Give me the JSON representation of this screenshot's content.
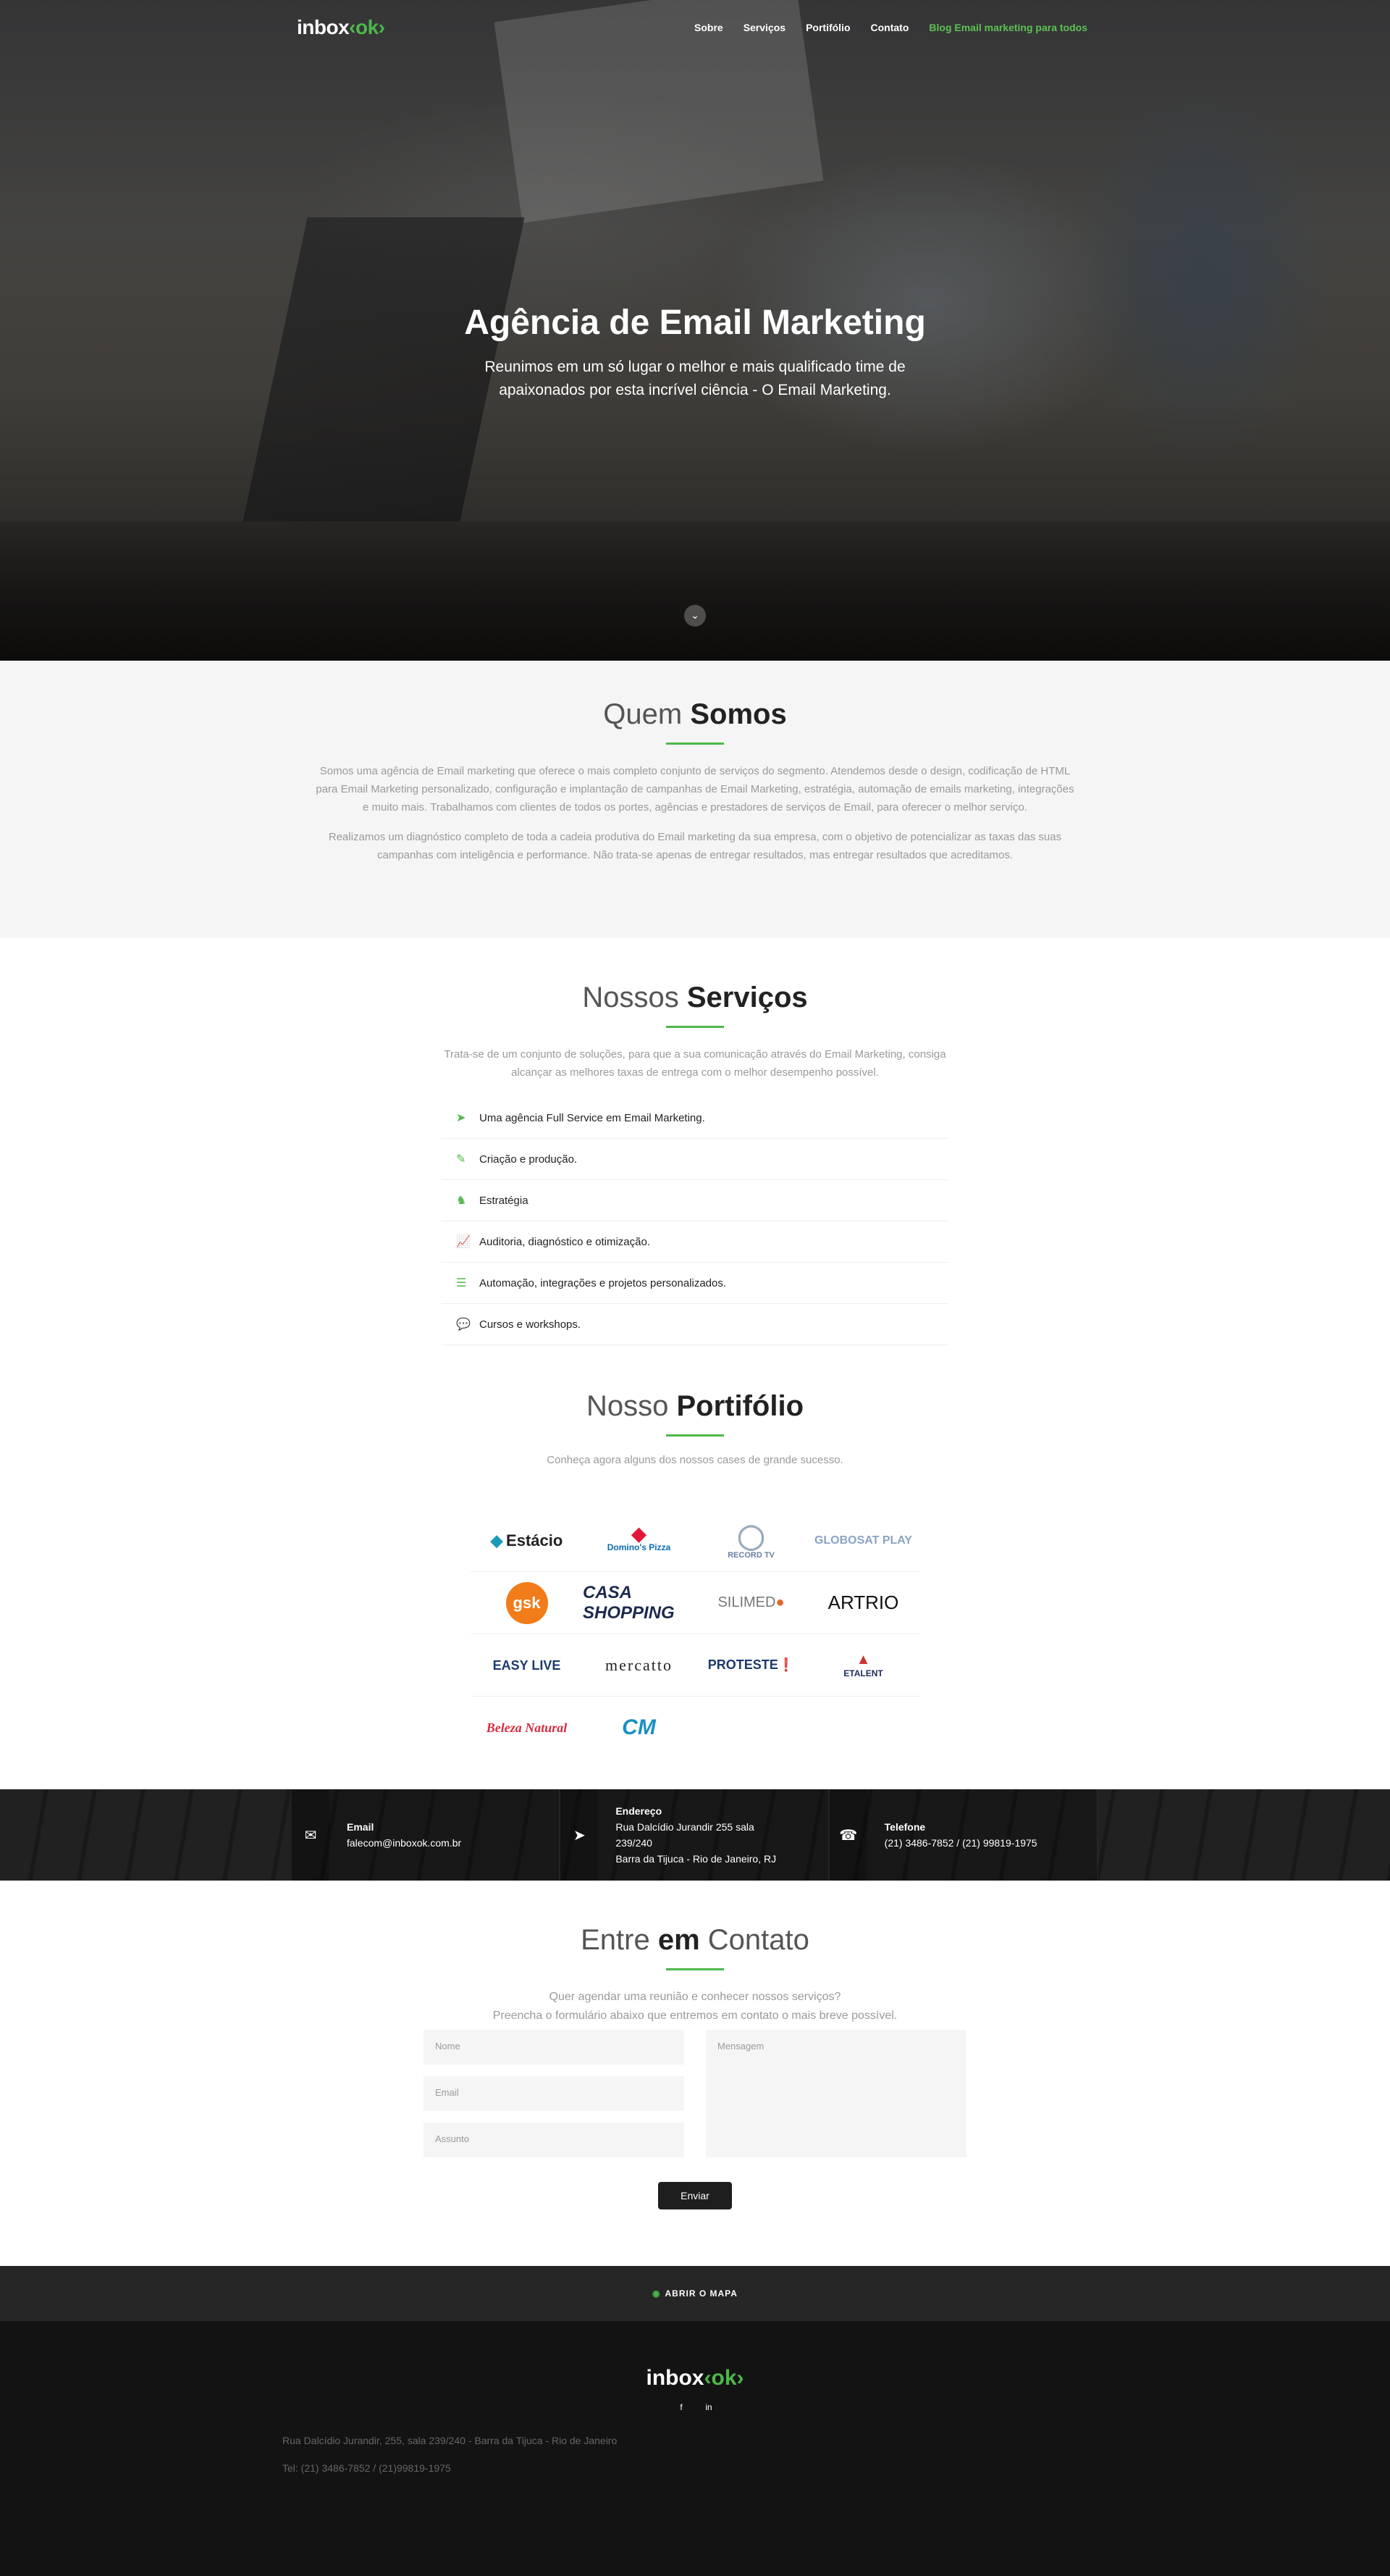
{
  "nav": {
    "logo_main": "inbox",
    "logo_accent": "‹ok›",
    "items": [
      "Sobre",
      "Serviços",
      "Portifólio",
      "Contato",
      "Blog Email marketing para todos"
    ]
  },
  "hero": {
    "title": "Agência de Email Marketing",
    "subtitle": "Reunimos em um só lugar o melhor e mais qualificado time de apaixonados por esta incrível ciência - O Email Marketing.",
    "scroll_icon": "chevron-down-icon"
  },
  "about": {
    "title_light": "Quem",
    "title_bold": "Somos",
    "paragraphs": [
      "Somos uma agência de Email marketing que oferece o mais completo conjunto de serviços do segmento. Atendemos desde o design, codificação de HTML para Email Marketing personalizado, configuração e implantação de campanhas de Email Marketing, estratégia, automação de emails marketing, integrações e muito mais. Trabalhamos com clientes de todos os portes, agências e prestadores de serviços de Email, para oferecer o melhor serviço.",
      "Realizamos um diagnóstico completo de toda a cadeia produtiva do Email marketing da sua empresa, com o objetivo de potencializar as taxas das suas campanhas com inteligência e performance. Não trata-se apenas de entregar resultados, mas entregar resultados que acreditamos."
    ]
  },
  "services": {
    "title_light": "Nossos",
    "title_bold": "Serviços",
    "intro": "Trata-se de um conjunto de soluções, para que a sua comunicação através do Email Marketing, consiga alcançar as melhores taxas de entrega com o melhor desempenho possível.",
    "items": [
      {
        "icon": "paper-plane-icon",
        "label": "Uma agência Full Service em Email Marketing."
      },
      {
        "icon": "pencil-icon",
        "label": "Criação e produção."
      },
      {
        "icon": "chess-piece-icon",
        "label": "Estratégia"
      },
      {
        "icon": "line-chart-icon",
        "label": "Auditoria, diagnóstico e otimização."
      },
      {
        "icon": "list-icon",
        "label": "Automação, integrações e projetos personalizados."
      },
      {
        "icon": "chat-bubbles-icon",
        "label": "Cursos e workshops."
      }
    ]
  },
  "portfolio": {
    "title_light": "Nosso",
    "title_bold": "Portifólio",
    "intro": "Conheça agora alguns dos nossos cases de grande sucesso.",
    "clients": [
      "Estácio",
      "Domino's Pizza",
      "RECORD TV",
      "GLOBOSAT PLAY",
      "gsk",
      "CASA SHOPPING",
      "SILIMED",
      "ARTRIO",
      "EASY LIVE",
      "mercatto",
      "PROTESTE",
      "ETALENT",
      "Beleza Natural",
      "CM"
    ]
  },
  "contact_strip": {
    "email_label": "Email",
    "email_value": "falecom@inboxok.com.br",
    "address_label": "Endereço",
    "address_line1": "Rua Dalcídio Jurandir 255 sala",
    "address_line2": "239/240",
    "address_line3": "Barra da Tijuca - Rio de Janeiro, RJ",
    "phone_label": "Telefone",
    "phone_value": "(21) 3486-7852 / (21) 99819-1975"
  },
  "contact": {
    "title_light1": "Entre",
    "title_bold": "em",
    "title_light2": "Contato",
    "intro_line1": "Quer agendar uma reunião e conhecer nossos serviços?",
    "intro_line2": "Preencha o formulário abaixo que entremos em contato o mais breve possível.",
    "name_placeholder": "Nome",
    "email_placeholder": "Email",
    "subject_placeholder": "Assunto",
    "message_placeholder": "Mensagem",
    "send_label": "Enviar"
  },
  "footer": {
    "map_label": "ABRIR O MAPA",
    "logo_main": "inbox",
    "logo_accent": "‹ok›",
    "social": [
      "f",
      "in"
    ],
    "address": "Rua Dalcídio Jurandir, 255, sala 239/240 - Barra da Tijuca - Rio de Janeiro",
    "phones": "Tel: (21) 3486-7852 / (21)99819-1975"
  },
  "colors": {
    "accent_green": "#4db849",
    "dark": "#1e1e1e",
    "footer_bg": "#131313"
  }
}
